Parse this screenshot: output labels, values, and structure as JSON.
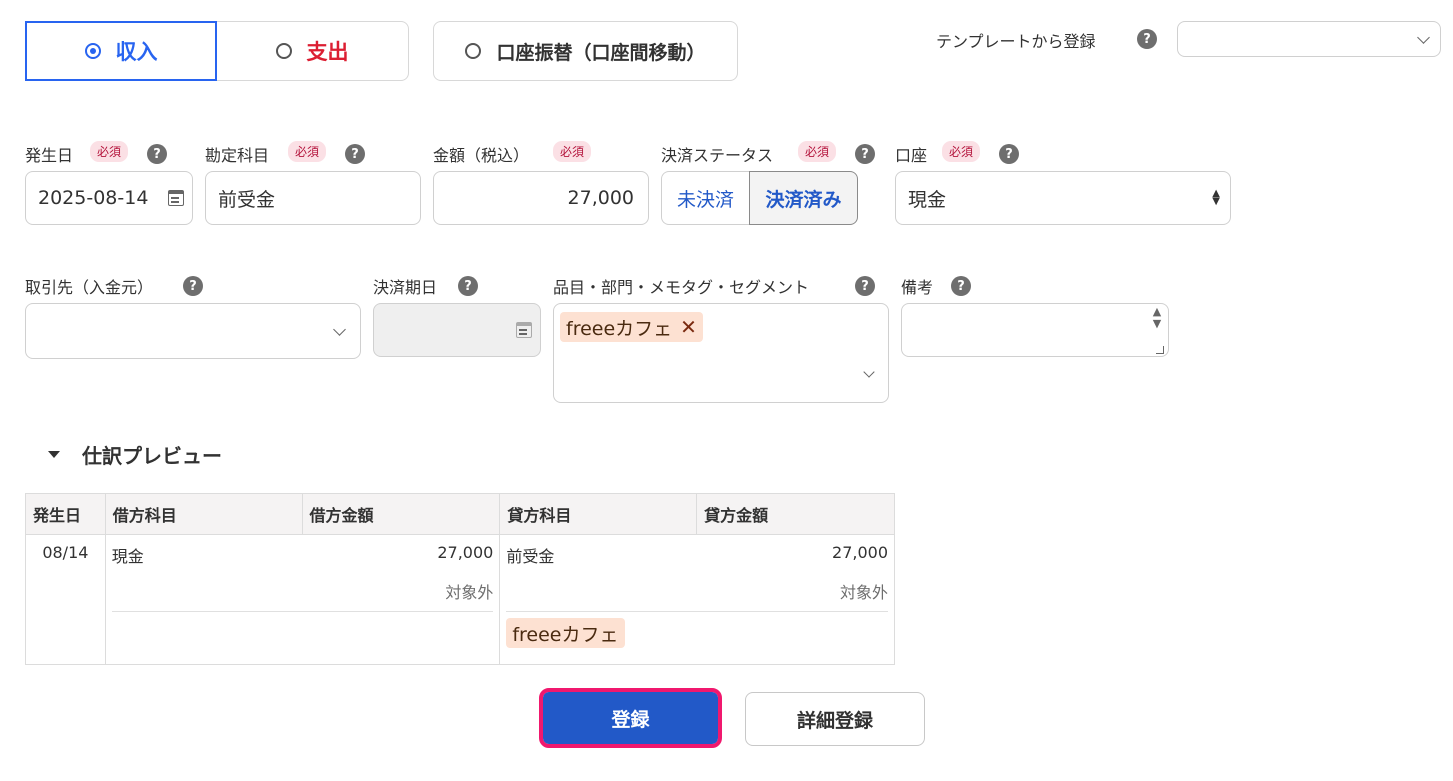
{
  "type_toggle": {
    "income_label": "収入",
    "expense_label": "支出",
    "transfer_label": "口座振替（口座間移動）",
    "selected": "income"
  },
  "template": {
    "label": "テンプレートから登録",
    "value": ""
  },
  "fields": {
    "issue_date": {
      "label": "発生日",
      "required": "必須",
      "value": "2025-08-14"
    },
    "account_item": {
      "label": "勘定科目",
      "required": "必須",
      "value": "前受金"
    },
    "amount": {
      "label": "金額（税込）",
      "required": "必須",
      "value": "27,000"
    },
    "settlement_status": {
      "label": "決済ステータス",
      "required": "必須",
      "options": [
        "未決済",
        "決済済み"
      ],
      "selected": "決済済み"
    },
    "wallet": {
      "label": "口座",
      "required": "必須",
      "value": "現金"
    },
    "partner": {
      "label": "取引先（入金元）",
      "value": ""
    },
    "due_date": {
      "label": "決済期日",
      "value": ""
    },
    "tags": {
      "label": "品目・部門・メモタグ・セグメント",
      "items": [
        "freeeカフェ"
      ]
    },
    "memo": {
      "label": "備考",
      "value": ""
    }
  },
  "preview": {
    "toggle_label": "仕訳プレビュー",
    "columns": [
      "発生日",
      "借方科目",
      "借方金額",
      "貸方科目",
      "貸方金額"
    ],
    "row": {
      "date": "08/14",
      "debit_account": "現金",
      "debit_amount": "27,000",
      "debit_tax": "対象外",
      "credit_account": "前受金",
      "credit_amount": "27,000",
      "credit_tax": "対象外",
      "credit_tag": "freeeカフェ"
    }
  },
  "actions": {
    "register_label": "登録",
    "detail_register_label": "詳細登録"
  },
  "help_glyph": "?",
  "colors": {
    "accent": "#2864f0",
    "expense": "#dc1e32",
    "primary_button": "#2259c8",
    "highlight": "#f0186e",
    "tag_bg": "#fde1d2",
    "required_bg": "#fbe0e5"
  }
}
